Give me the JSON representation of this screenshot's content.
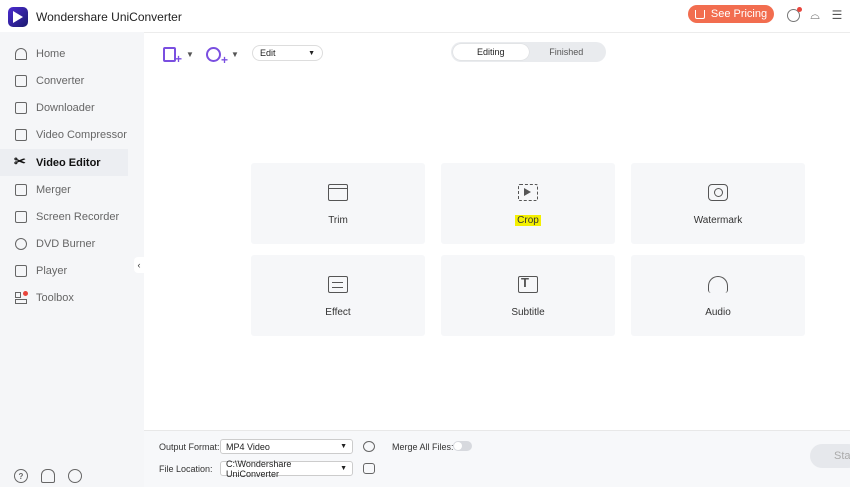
{
  "app": {
    "title": "Wondershare UniConverter",
    "pricing_label": "See Pricing"
  },
  "sidebar": {
    "items": [
      {
        "label": "Home",
        "icon": "home-icon"
      },
      {
        "label": "Converter",
        "icon": "converter-icon"
      },
      {
        "label": "Downloader",
        "icon": "downloader-icon"
      },
      {
        "label": "Video Compressor",
        "icon": "compressor-icon"
      },
      {
        "label": "Video Editor",
        "icon": "scissors-icon",
        "active": true
      },
      {
        "label": "Merger",
        "icon": "merger-icon"
      },
      {
        "label": "Screen Recorder",
        "icon": "screen-recorder-icon"
      },
      {
        "label": "DVD Burner",
        "icon": "dvd-icon"
      },
      {
        "label": "Player",
        "icon": "player-icon"
      },
      {
        "label": "Toolbox",
        "icon": "toolbox-icon"
      }
    ],
    "footer_icons": [
      "help-icon",
      "notification-bell-icon",
      "feedback-icon"
    ]
  },
  "toolbar": {
    "mode_select": "Edit"
  },
  "tabs": [
    {
      "label": "Editing",
      "active": true
    },
    {
      "label": "Finished",
      "active": false
    }
  ],
  "tools": [
    {
      "label": "Trim",
      "icon": "trim-icon"
    },
    {
      "label": "Crop",
      "icon": "crop-icon",
      "highlighted": true
    },
    {
      "label": "Watermark",
      "icon": "watermark-icon"
    },
    {
      "label": "Effect",
      "icon": "effect-icon"
    },
    {
      "label": "Subtitle",
      "icon": "subtitle-icon"
    },
    {
      "label": "Audio",
      "icon": "audio-icon"
    }
  ],
  "bottom": {
    "output_format_label": "Output Format:",
    "output_format_value": "MP4 Video",
    "merge_label": "Merge All Files:",
    "merge_enabled": false,
    "file_location_label": "File Location:",
    "file_location_value": "C:\\Wondershare UniConverter",
    "start_label": "Sta"
  },
  "colors": {
    "accent": "#7a4fe0",
    "pricing": "#f26d4f",
    "highlight": "#f4f000"
  }
}
